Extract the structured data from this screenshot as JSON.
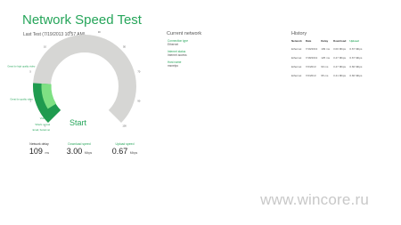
{
  "app": {
    "title": "Network Speed Test",
    "last_test": "Last Test (7/19/2013 10:57 AM)"
  },
  "gauge": {
    "start_label": "Start",
    "ticks": [
      "0",
      "1",
      "5",
      "10",
      "20",
      "30",
      "50",
      "70",
      "90",
      "100"
    ],
    "level_labels": [
      "Great for high quality video",
      "Great for quality video",
      "Video call",
      "What's normal",
      "Email, Social net"
    ],
    "fill_fraction": 0.18,
    "track_color": "#d6d6d4",
    "fill_color": "#1f9b4f",
    "accent_color": "#7ee083"
  },
  "stats": {
    "delay": {
      "label": "Network delay",
      "value": "109",
      "unit": "ms"
    },
    "download": {
      "label": "Download speed",
      "value": "3.00",
      "unit": "Mbps"
    },
    "upload": {
      "label": "Upload speed",
      "value": "0.67",
      "unit": "Mbps"
    }
  },
  "current_network": {
    "title": "Current network",
    "connection_type_label": "Connection type",
    "connection_type": "Ethernet",
    "internet_status_label": "Internet status",
    "internet_status": "Internet access",
    "host_name_label": "Host name",
    "host_name": "msnetpc"
  },
  "history": {
    "title": "History",
    "columns": [
      "Network",
      "Date",
      "Delay",
      "Download",
      "Upload"
    ],
    "rows": [
      [
        "Ethernet",
        "7/19/2013",
        "109 ms",
        "3.00 Mbps",
        "0.67 Mbps"
      ],
      [
        "Ethernet",
        "7/18/2013",
        "125 ms",
        "3.47 Mbps",
        "0.67 Mbps"
      ],
      [
        "Ethernet",
        "7/2/2013",
        "90 ms",
        "3.47 Mbps",
        "0.66 Mbps"
      ],
      [
        "Ethernet",
        "7/2/2013",
        "95 ms",
        "3.41 Mbps",
        "0.66 Mbps"
      ]
    ]
  },
  "watermark": "www.wincore.ru"
}
